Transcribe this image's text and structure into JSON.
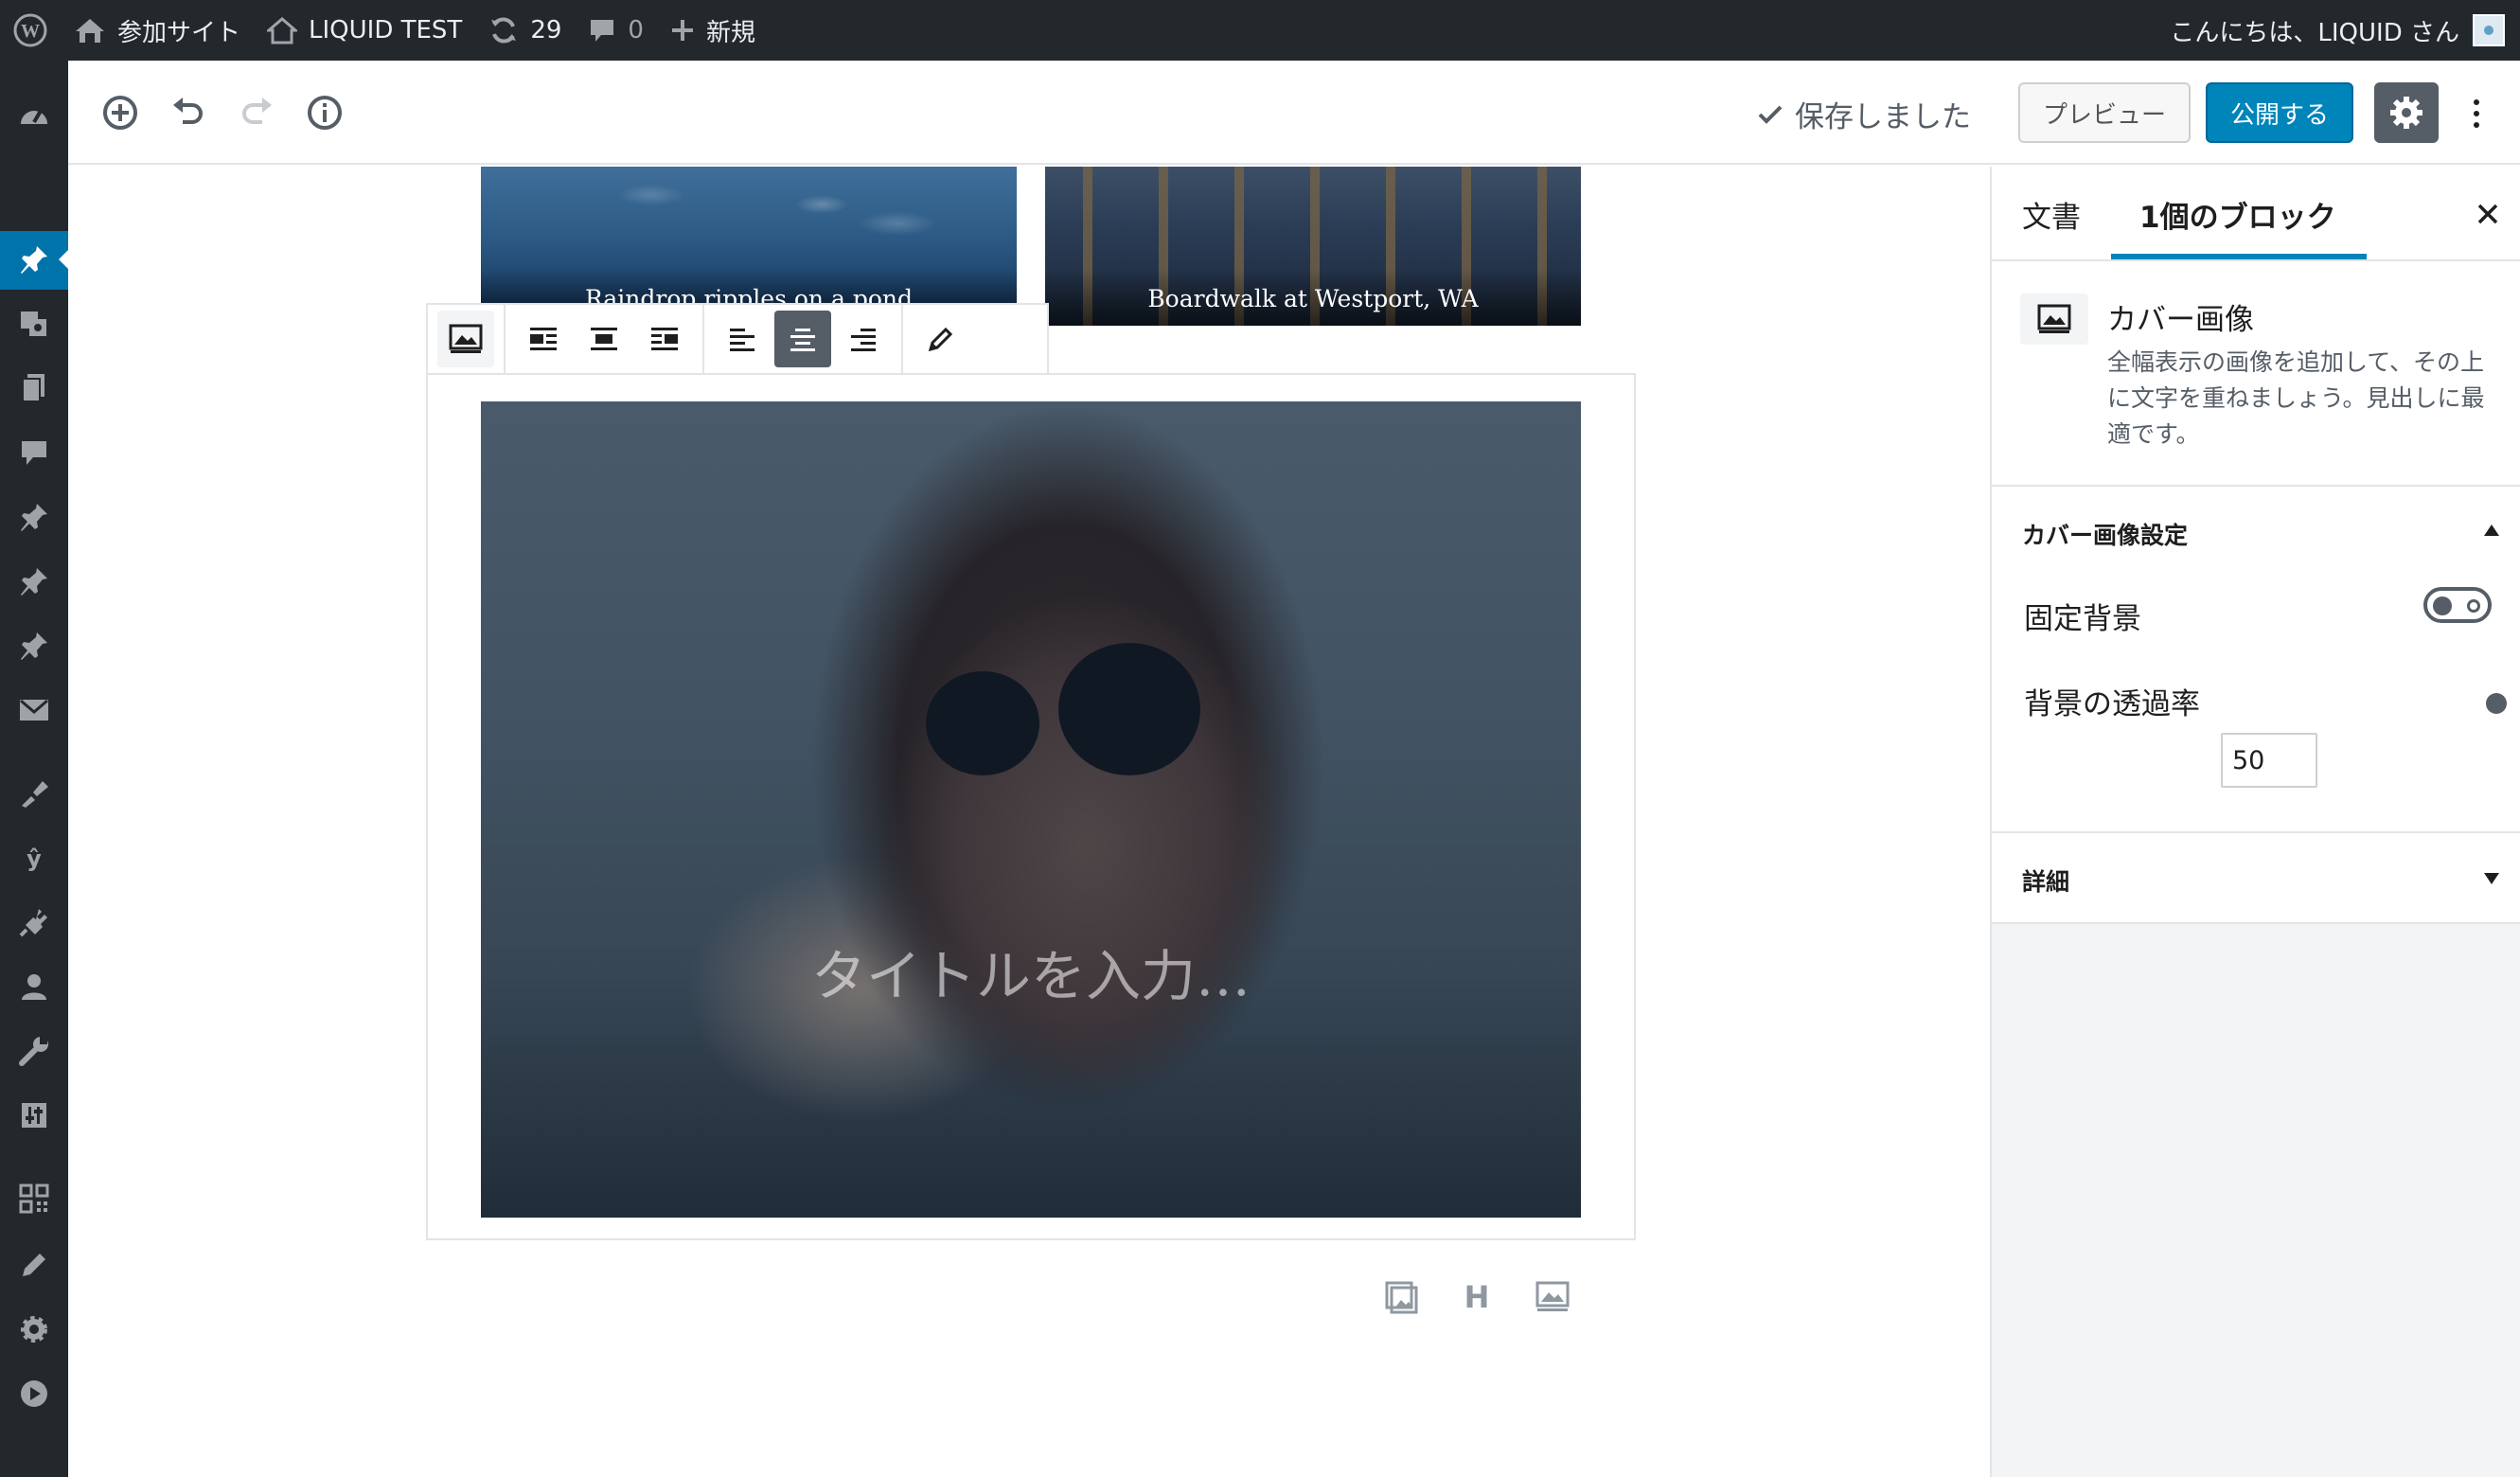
{
  "admin_bar": {
    "site_name": "参加サイト",
    "site_title": "LIQUID TEST",
    "updates_count": "29",
    "comments_count": "0",
    "new_label": "新規",
    "greeting": "こんにちは、LIQUID さん"
  },
  "header": {
    "saved_status": "保存しました",
    "preview_label": "プレビュー",
    "publish_label": "公開する"
  },
  "canvas": {
    "gallery": [
      {
        "caption": "Raindrop ripples on a pond"
      },
      {
        "caption": "Boardwalk at Westport, WA"
      }
    ],
    "cover": {
      "title_placeholder": "タイトルを入力…"
    },
    "shortcut_heading": "H"
  },
  "sidebar": {
    "tabs": {
      "document": "文書",
      "block": "1個のブロック"
    },
    "block": {
      "title": "カバー画像",
      "description": "全幅表示の画像を追加して、その上に文字を重ねましょう。見出しに最適です。"
    },
    "cover_settings": {
      "title": "カバー画像設定",
      "fixed_background_label": "固定背景",
      "fixed_background_on": false,
      "opacity_label": "背景の透過率",
      "opacity_value": "50"
    },
    "advanced": {
      "title": "詳細"
    }
  },
  "colors": {
    "admin_bar_bg": "#23282d",
    "accent": "#0085ba",
    "active_menu": "#0073aa"
  }
}
